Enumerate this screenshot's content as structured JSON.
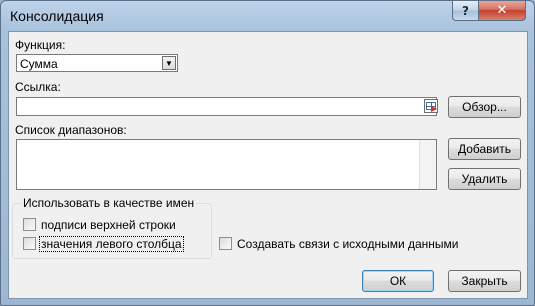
{
  "window": {
    "title": "Консолидация"
  },
  "titlebar": {
    "help_glyph": "?",
    "close_glyph": "✕"
  },
  "function": {
    "label": "Функция:",
    "value": "Сумма",
    "arrow_glyph": "▼"
  },
  "reference": {
    "label": "Ссылка:",
    "value": "",
    "browse_label": "Обзор..."
  },
  "ranges": {
    "label": "Список диапазонов:",
    "add_label": "Добавить",
    "delete_label": "Удалить"
  },
  "use_labels": {
    "title": "Использовать в качестве имен",
    "top_row": {
      "label": "подписи верхней строки",
      "checked": false
    },
    "left_column": {
      "label": "значения левого столбца",
      "checked": false
    }
  },
  "create_links": {
    "label": "Создавать связи с исходными данными",
    "checked": false
  },
  "footer": {
    "ok_label": "ОК",
    "close_label": "Закрыть"
  }
}
